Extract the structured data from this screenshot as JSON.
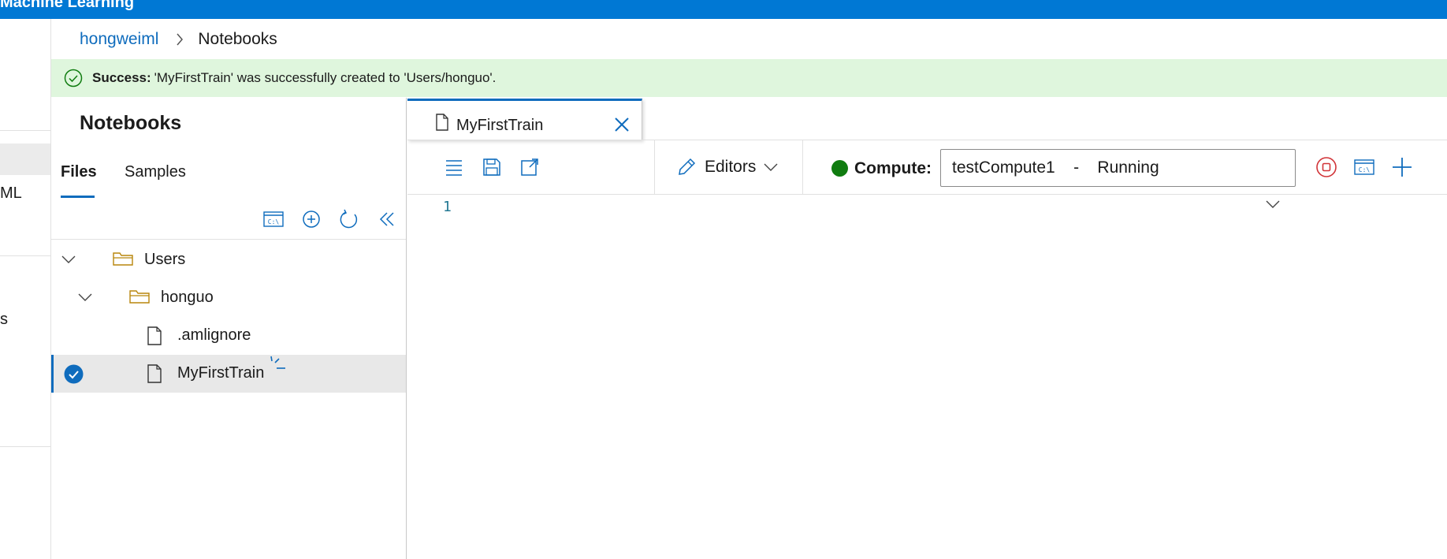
{
  "app": {
    "title": "Machine Learning"
  },
  "left_nav": {
    "items": [
      "ML",
      "s"
    ]
  },
  "breadcrumb": {
    "workspace": "hongweiml",
    "current": "Notebooks"
  },
  "banner": {
    "label": "Success:",
    "message": "'MyFirstTrain' was successfully created to 'Users/honguo'.",
    "color": "#dff6dd"
  },
  "panel": {
    "title": "Notebooks",
    "tabs": [
      {
        "label": "Files",
        "selected": true
      },
      {
        "label": "Samples",
        "selected": false
      }
    ],
    "toolbar_icons": [
      "terminal-icon",
      "add-icon",
      "refresh-icon",
      "collapse-icon"
    ]
  },
  "tree": [
    {
      "label": "Users",
      "type": "folder",
      "expanded": true
    },
    {
      "label": "honguo",
      "type": "folder",
      "expanded": true
    },
    {
      "label": ".amlignore",
      "type": "file"
    },
    {
      "label": "MyFirstTrain",
      "type": "file",
      "selected": true
    }
  ],
  "editor_tab": {
    "label": "MyFirstTrain"
  },
  "toolbar": {
    "icons": [
      "menu-icon",
      "save-icon",
      "open-external-icon"
    ],
    "editors_label": "Editors",
    "compute_label": "Compute:",
    "compute_status_color": "#107c10",
    "compute_value": "testCompute1    -    Running",
    "action_icons": [
      "stop-compute-icon",
      "terminal-icon",
      "add-compute-icon"
    ]
  },
  "editor": {
    "line_numbers": [
      "1"
    ]
  },
  "colors": {
    "accent": "#0078d4",
    "link": "#0f6cbd",
    "success_bg": "#dff6dd",
    "running": "#107c10",
    "stop": "#d13438"
  }
}
